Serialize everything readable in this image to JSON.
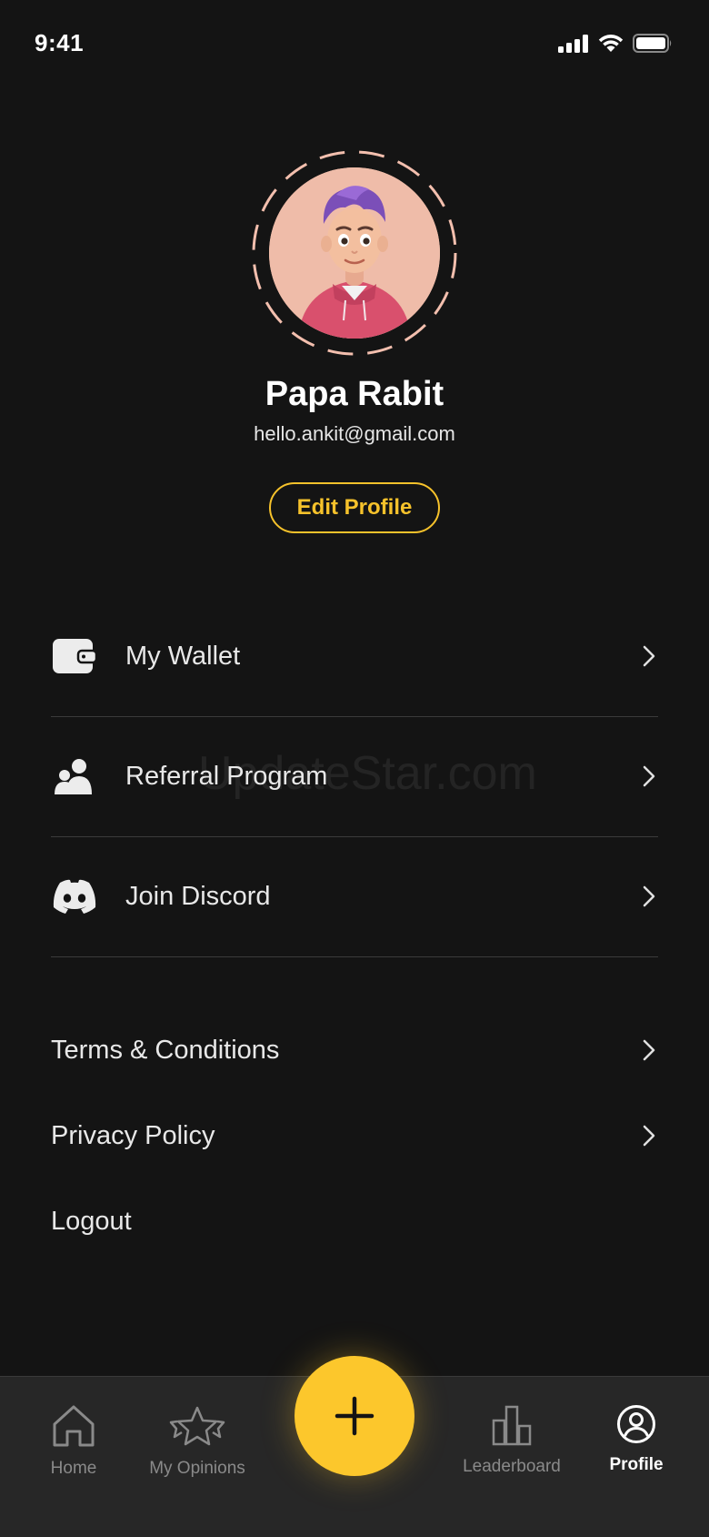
{
  "status_bar": {
    "time": "9:41"
  },
  "profile": {
    "name": "Papa Rabit",
    "email": "hello.ankit@gmail.com",
    "edit_button_label": "Edit Profile"
  },
  "menu": {
    "items": [
      {
        "label": "My Wallet",
        "icon": "wallet-icon"
      },
      {
        "label": "Referral Program",
        "icon": "users-icon"
      },
      {
        "label": "Join Discord",
        "icon": "discord-icon"
      }
    ]
  },
  "links": {
    "terms": "Terms & Conditions",
    "privacy": "Privacy Policy",
    "logout": "Logout"
  },
  "watermark": "UpdateStar.com",
  "tab_bar": {
    "tabs": [
      {
        "label": "Home",
        "icon": "home-icon"
      },
      {
        "label": "My Opinions",
        "icon": "stars-icon"
      },
      {
        "label": "Leaderboard",
        "icon": "bar-chart-icon"
      },
      {
        "label": "Profile",
        "icon": "profile-icon"
      }
    ],
    "active": "Profile"
  },
  "colors": {
    "background": "#141414",
    "accent": "#fcc72c",
    "tab_bar": "#272727"
  }
}
